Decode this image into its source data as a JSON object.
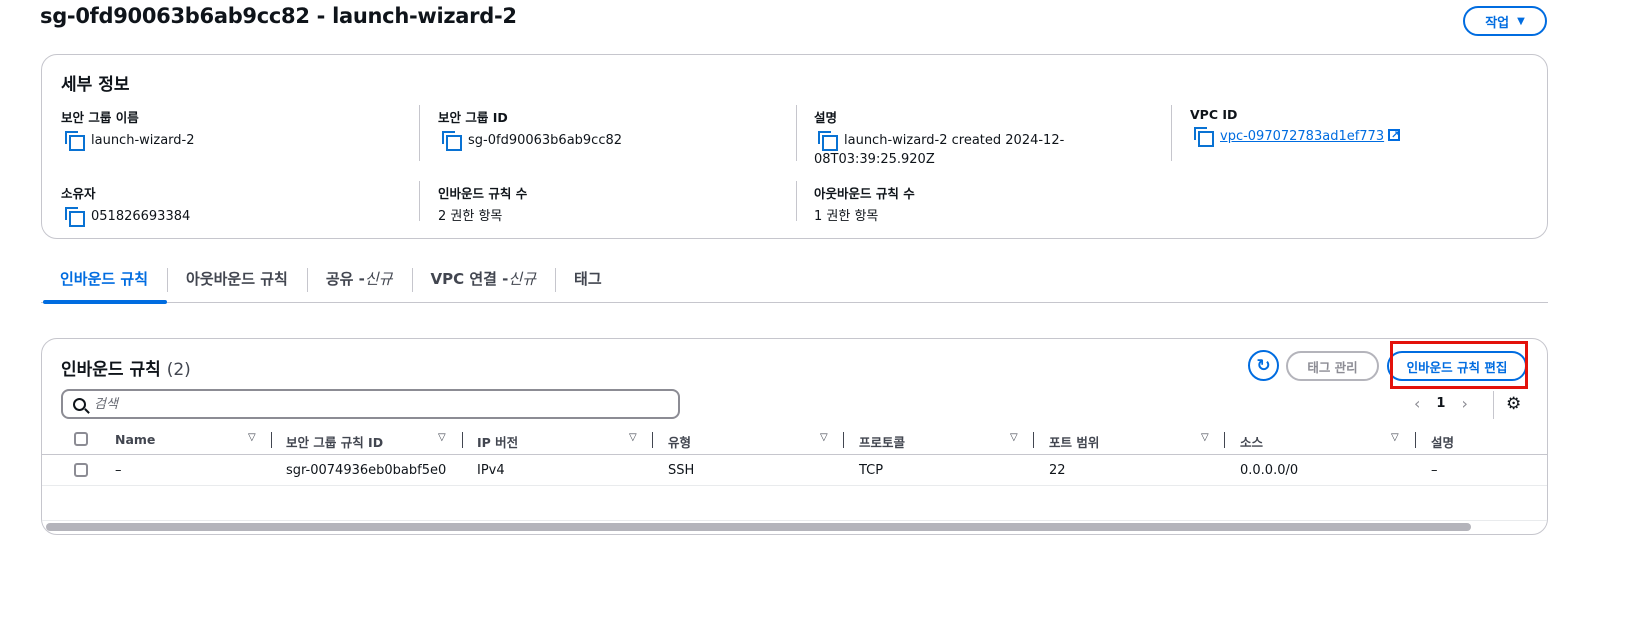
{
  "header": {
    "title": "sg-0fd90063b6ab9cc82 - launch-wizard-2",
    "actions_label": "작업"
  },
  "details": {
    "title": "세부 정보",
    "fields": {
      "sg_name": {
        "label": "보안 그룹 이름",
        "value": "launch-wizard-2"
      },
      "sg_id": {
        "label": "보안 그룹 ID",
        "value": "sg-0fd90063b6ab9cc82"
      },
      "description": {
        "label": "설명",
        "value_line1": "launch-wizard-2 created 2024-12-",
        "value_line2": "08T03:39:25.920Z"
      },
      "vpc_id": {
        "label": "VPC ID",
        "value": "vpc-097072783ad1ef773"
      },
      "owner": {
        "label": "소유자",
        "value": "051826693384"
      },
      "inbound_count": {
        "label": "인바운드 규칙 수",
        "value": "2 권한 항목"
      },
      "outbound_count": {
        "label": "아웃바운드 규칙 수",
        "value": "1 권한 항목"
      }
    }
  },
  "tabs": [
    {
      "label": "인바운드 규칙",
      "suffix": "",
      "active": true
    },
    {
      "label": "아웃바운드 규칙",
      "suffix": "",
      "active": false
    },
    {
      "label": "공유 - ",
      "suffix": "신규",
      "active": false
    },
    {
      "label": "VPC 연결 - ",
      "suffix": "신규",
      "active": false
    },
    {
      "label": "태그",
      "suffix": "",
      "active": false
    }
  ],
  "rules": {
    "title": "인바운드 규칙",
    "count": "(2)",
    "manage_tags_label": "태그 관리",
    "edit_rules_label": "인바운드 규칙 편집",
    "search_placeholder": "검색",
    "page": "1",
    "columns": [
      "Name",
      "보안 그룹 규칙 ID",
      "IP 버전",
      "유형",
      "프로토콜",
      "포트 범위",
      "소스",
      "설명"
    ],
    "rows": [
      {
        "name": "–",
        "rule_id": "sgr-0074936eb0babf5e0",
        "ip_version": "IPv4",
        "type": "SSH",
        "protocol": "TCP",
        "port_range": "22",
        "source": "0.0.0.0/0",
        "description": "–"
      }
    ]
  },
  "colors": {
    "accent": "#006ce0",
    "highlight": "#e3120b",
    "border": "#c6c6cd"
  }
}
